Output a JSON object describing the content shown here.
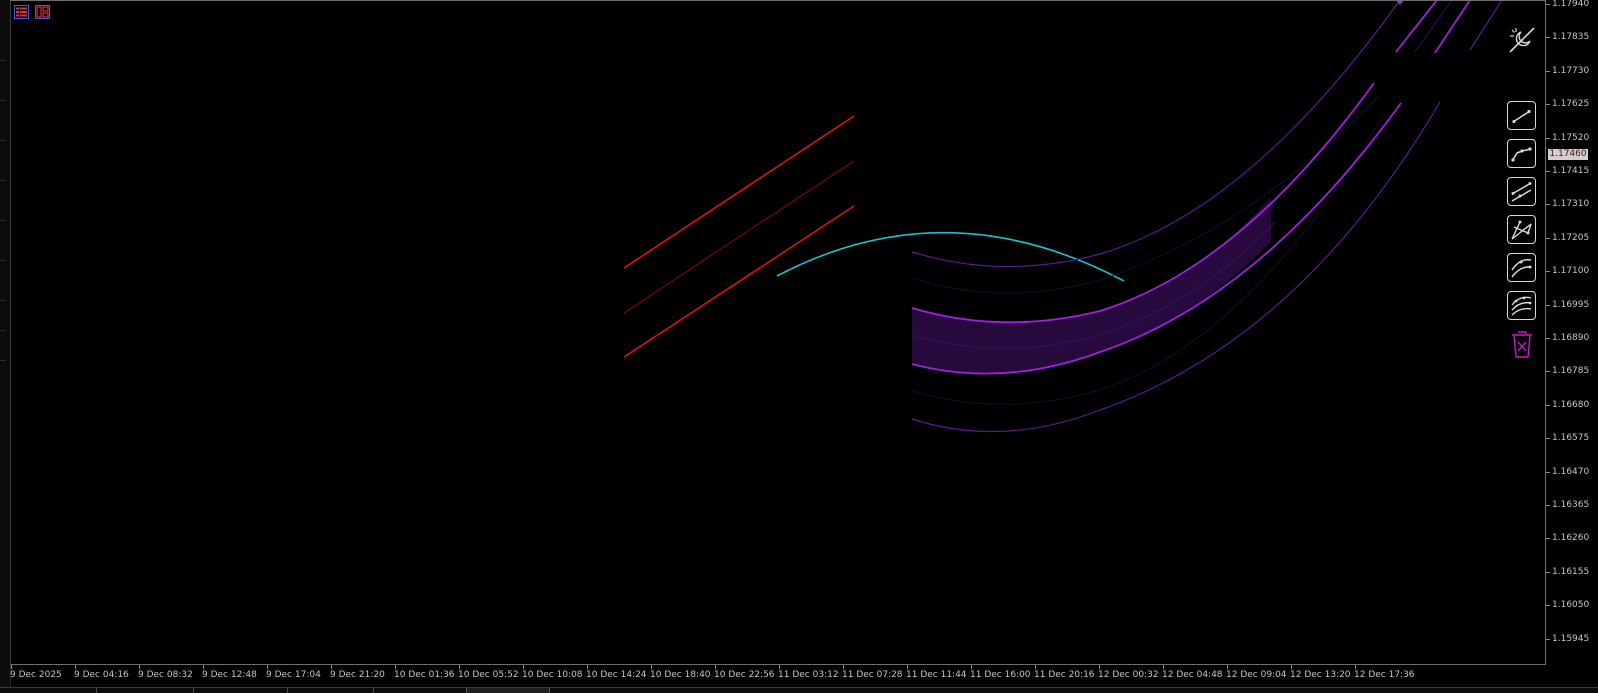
{
  "app": {
    "accent_colors": {
      "background": "#000000",
      "axis_text": "#c4c4c4",
      "red_channel": "#e01010",
      "red_channel_mid": "#8a0a0a",
      "cyan_arc": "#19c3c9",
      "purple_band": "#a020e0",
      "purple_fill": "#2a0a40",
      "purple_faint": "#3a1060",
      "tool_icon": "#d8d8d8",
      "trash_icon": "#c020c0"
    }
  },
  "top_icons": [
    {
      "name": "grid-list-icon",
      "color": "#e03030"
    },
    {
      "name": "chart-grid-icon",
      "color": "#e03030"
    }
  ],
  "price_axis": {
    "labels": [
      "1.17940",
      "1.17835",
      "1.17730",
      "1.17625",
      "1.17520",
      "1.17415",
      "1.17310",
      "1.17205",
      "1.17100",
      "1.16995",
      "1.16890",
      "1.16785",
      "1.16680",
      "1.16575",
      "1.16470",
      "1.16365",
      "1.16260",
      "1.16155",
      "1.16050",
      "1.15945"
    ],
    "current_price": "1.17460"
  },
  "time_axis": {
    "labels": [
      "9 Dec 2025",
      "9 Dec 04:16",
      "9 Dec 08:32",
      "9 Dec 12:48",
      "9 Dec 17:04",
      "9 Dec 21:20",
      "10 Dec 01:36",
      "10 Dec 05:52",
      "10 Dec 10:08",
      "10 Dec 14:24",
      "10 Dec 18:40",
      "10 Dec 22:56",
      "11 Dec 03:12",
      "11 Dec 07:28",
      "11 Dec 11:44",
      "11 Dec 16:00",
      "11 Dec 20:16",
      "12 Dec 00:32",
      "12 Dec 04:48",
      "12 Dec 09:04",
      "12 Dec 13:20",
      "12 Dec 17:36"
    ]
  },
  "toolbar": {
    "ghost_tool": "magic-wand-night-icon",
    "tools": [
      {
        "name": "trendline-2pt-icon"
      },
      {
        "name": "trendline-3pt-icon"
      },
      {
        "name": "channel-icon"
      },
      {
        "name": "pitchfork-icon"
      },
      {
        "name": "curve-channel-icon"
      },
      {
        "name": "multi-curve-icon"
      }
    ],
    "trash": "trash-icon"
  }
}
